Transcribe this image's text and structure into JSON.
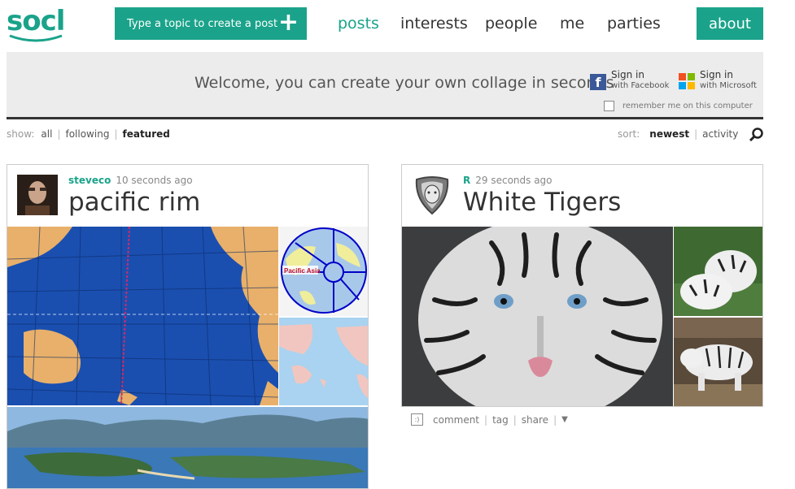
{
  "header": {
    "logo": "socl",
    "create_post_label": "Type a topic to create a post",
    "create_post_icon": "plus-icon",
    "nav": [
      {
        "label": "posts",
        "active": true
      },
      {
        "label": "interests",
        "active": false
      },
      {
        "label": "people",
        "active": false
      },
      {
        "label": "me",
        "active": false
      },
      {
        "label": "parties",
        "active": false
      }
    ],
    "about_label": "about"
  },
  "banner": {
    "welcome": "Welcome, you can create your own collage in seconds",
    "facebook": {
      "line1": "Sign in",
      "line2": "with Facebook",
      "icon": "facebook-icon"
    },
    "microsoft": {
      "line1": "Sign in",
      "line2": "with Microsoft",
      "icon": "microsoft-icon"
    },
    "remember_label": "remember me on this computer"
  },
  "filters": {
    "show_label": "show:",
    "show_options": [
      {
        "label": "all",
        "selected": false
      },
      {
        "label": "following",
        "selected": false
      },
      {
        "label": "featured",
        "selected": true
      }
    ],
    "sort_label": "sort:",
    "sort_options": [
      {
        "label": "newest",
        "selected": true
      },
      {
        "label": "activity",
        "selected": false
      }
    ]
  },
  "posts": [
    {
      "author": "steveco",
      "time": "10 seconds ago",
      "title": "pacific rim"
    },
    {
      "author": "R",
      "time": "29 seconds ago",
      "title": "White Tigers",
      "actions": [
        "comment",
        "tag",
        "share"
      ]
    }
  ],
  "colors": {
    "accent": "#1aa38a",
    "banner_bg": "#ececec",
    "text": "#333333"
  }
}
